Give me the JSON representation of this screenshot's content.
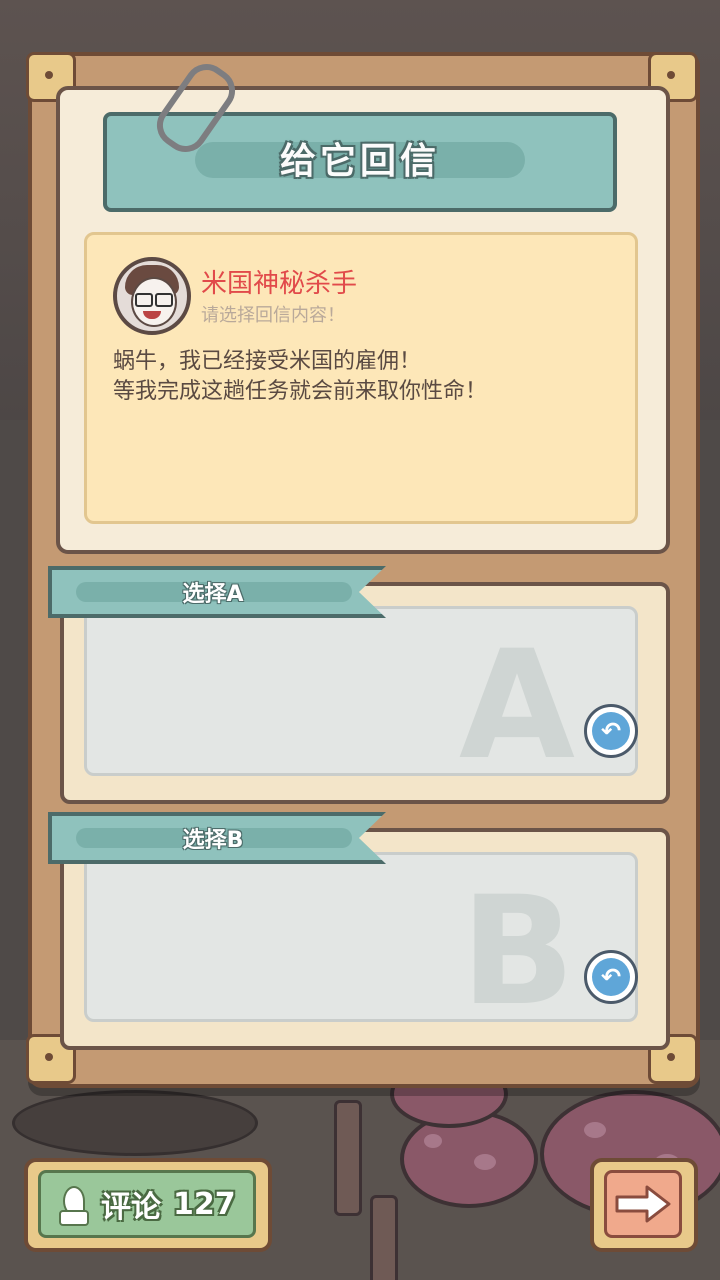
{
  "title": "给它回信",
  "message": {
    "sender": "米国神秘杀手",
    "hint": "请选择回信内容！",
    "body": "蜗牛，我已经接受米国的雇佣！\n等我完成这趟任务就会前来取你性命！"
  },
  "choices": [
    {
      "label": "选择A",
      "letter": "A"
    },
    {
      "label": "选择B",
      "letter": "B"
    }
  ],
  "comment": {
    "label": "评论",
    "count": "127"
  },
  "icons": {
    "undo": "undo-arrow-icon",
    "next": "right-arrow-icon",
    "comment": "feather-ink-icon",
    "clip": "paperclip-icon"
  },
  "colors": {
    "banner": "#8fc2bd",
    "sender_name": "#e14a4a",
    "card": "#fde7b8",
    "comment_btn": "#9ac79a",
    "next_btn": "#f0a98c"
  }
}
